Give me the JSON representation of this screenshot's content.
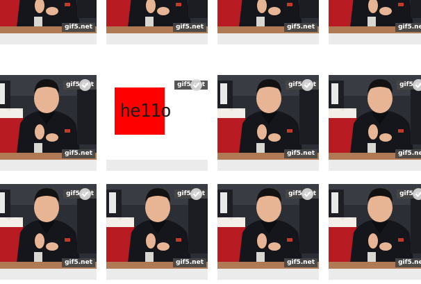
{
  "gallery": {
    "watermark": "gif5.net",
    "top_watermark_partial": "gif5.net",
    "hello_text": "he11o",
    "tiles": [
      {
        "kind": "photo",
        "selectable": false
      },
      {
        "kind": "photo",
        "selectable": false
      },
      {
        "kind": "photo",
        "selectable": false
      },
      {
        "kind": "photo",
        "selectable": false
      },
      {
        "kind": "photo",
        "selectable": true
      },
      {
        "kind": "hello",
        "selectable": true
      },
      {
        "kind": "photo",
        "selectable": true
      },
      {
        "kind": "photo",
        "selectable": true
      },
      {
        "kind": "photo",
        "selectable": true
      },
      {
        "kind": "photo",
        "selectable": true
      },
      {
        "kind": "photo",
        "selectable": true
      },
      {
        "kind": "photo",
        "selectable": true
      }
    ]
  },
  "colors": {
    "accent_red": "#ff0000",
    "card_bg": "#ebebeb",
    "watermark_bg": "#464646"
  },
  "icons": [
    "check-icon"
  ]
}
